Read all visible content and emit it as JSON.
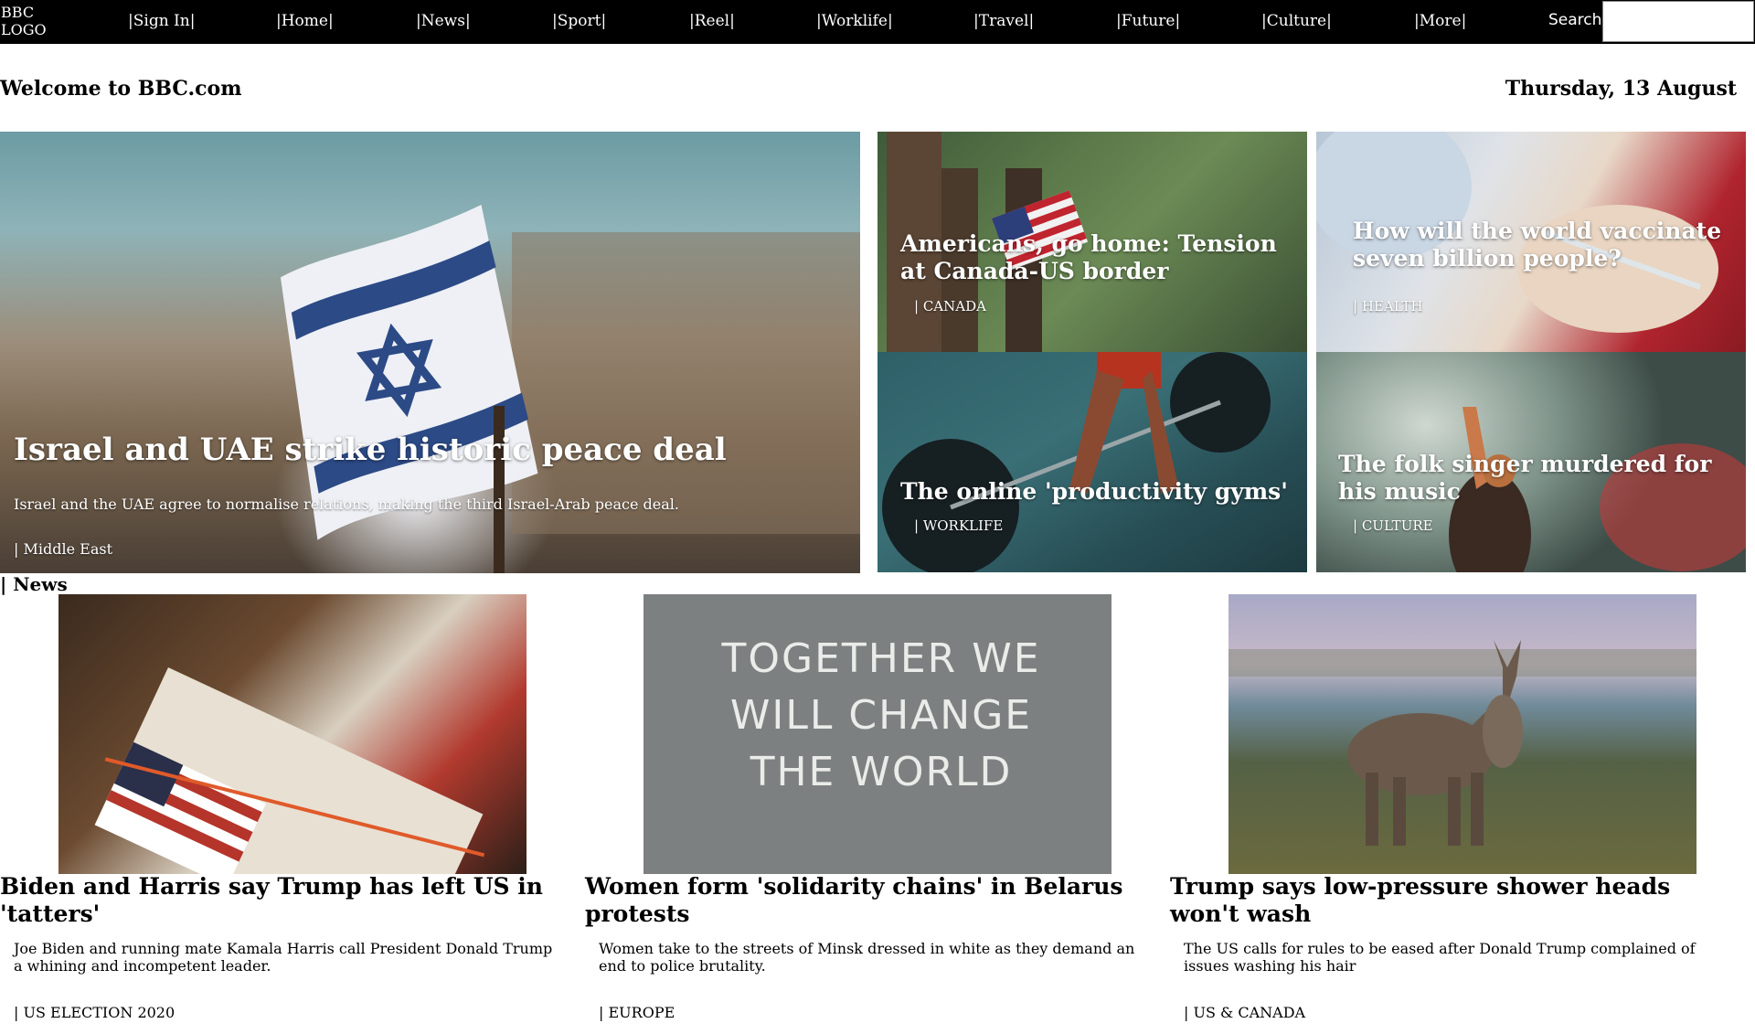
{
  "nav": {
    "logo": "BBC LOGO",
    "links": [
      "Sign In",
      "Home",
      "News",
      "Sport",
      "Reel",
      "Worklife",
      "Travel",
      "Future",
      "Culture",
      "More"
    ],
    "search_label": "Search",
    "search_placeholder": ""
  },
  "header": {
    "welcome": "Welcome to BBC.com",
    "date": "Thursday, 13 August"
  },
  "hero": {
    "main": {
      "title": "Israel and UAE strike historic peace deal",
      "description": "Israel and the UAE agree to normalise relations, making the third Israel-Arab peace deal.",
      "tag": "Middle East"
    },
    "canada": {
      "title": "Americans, go home: Tension at Canada-US border",
      "tag": "CANADA"
    },
    "health": {
      "title": "How will the world vaccinate seven billion people?",
      "tag": "HEALTH"
    },
    "worklife": {
      "title": "The online 'productivity gyms'",
      "tag": "WORKLIFE"
    },
    "culture": {
      "title": "The folk singer murdered for his music",
      "tag": "CULTURE"
    }
  },
  "news": {
    "section_label": "News",
    "chalk_text": "TOGETHER WE WILL CHANGE THE WORLD",
    "cards": [
      {
        "title": "Biden and Harris say Trump has left US in 'tatters'",
        "description": "Joe Biden and running mate Kamala Harris call President Donald Trump a whining and incompetent leader.",
        "tag": "US ELECTION 2020"
      },
      {
        "title": "Women form 'solidarity chains' in Belarus protests",
        "description": "Women take to the streets of Minsk dressed in white as they demand an end to police brutality.",
        "tag": "EUROPE"
      },
      {
        "title": "Trump says low-pressure shower heads won't wash",
        "description": "The US calls for rules to be eased after Donald Trump complained of issues washing his hair",
        "tag": "US & CANADA"
      }
    ]
  }
}
